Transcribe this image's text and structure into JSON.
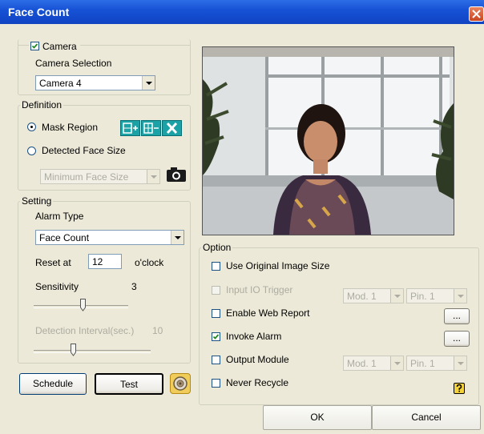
{
  "window": {
    "title": "Face Count"
  },
  "camera": {
    "checkbox_label": "Camera",
    "checked": true,
    "selection_label": "Camera Selection",
    "selected": "Camera 4"
  },
  "definition": {
    "legend": "Definition",
    "mask_region_label": "Mask Region",
    "detected_face_label": "Detected Face Size",
    "face_size_selected": "Minimum Face Size",
    "mask_region_selected": true
  },
  "setting": {
    "legend": "Setting",
    "alarm_type_label": "Alarm Type",
    "alarm_type_selected": "Face Count",
    "reset_label": "Reset at",
    "reset_value": "12",
    "reset_unit": "o'clock",
    "sensitivity_label": "Sensitivity",
    "sensitivity_value": "3",
    "detection_label": "Detection Interval(sec.)",
    "detection_value": "10"
  },
  "buttons": {
    "schedule": "Schedule",
    "test": "Test",
    "ok": "OK",
    "cancel": "Cancel",
    "more1": "...",
    "more2": "..."
  },
  "option": {
    "legend": "Option",
    "use_original": "Use Original Image Size",
    "input_io": "Input IO Trigger",
    "enable_web": "Enable Web Report",
    "invoke_alarm": "Invoke Alarm",
    "invoke_alarm_checked": true,
    "output_module": "Output Module",
    "never_recycle": "Never Recycle",
    "mod1": "Mod. 1",
    "pin1": "Pin. 1",
    "mod2": "Mod. 1",
    "pin2": "Pin. 1"
  },
  "colors": {
    "title_bar": "#1752d6",
    "panel": "#ece9d8",
    "accent_icon": "#1aa2a6"
  },
  "icons": [
    "close-icon",
    "mask-add-icon",
    "mask-remove-icon",
    "mask-clear-icon",
    "camera-snapshot-icon",
    "test-sound-icon",
    "help-icon"
  ]
}
